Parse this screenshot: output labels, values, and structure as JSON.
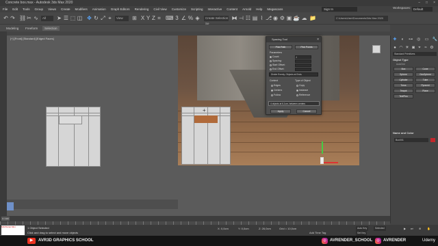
{
  "window": {
    "title": "Concrete box.max - Autodesk 3ds Max 2020"
  },
  "menu": {
    "items": [
      "File",
      "Edit",
      "Tools",
      "Group",
      "Views",
      "Create",
      "Modifiers",
      "Animation",
      "Graph Editors",
      "Rendering",
      "Civil View",
      "Customize",
      "Scripting",
      "Interactive",
      "Content",
      "Arnold",
      "Help",
      "Megascans"
    ],
    "sign_in": "Sign In",
    "workspaces_label": "Workspaces:",
    "workspace_value": "Default"
  },
  "toolbar": {
    "selection_filter": "All",
    "view_dropdown": "View",
    "create_selection_set": "Create Selection Se",
    "path": "C:\\Users\\User\\Documents\\3ds Max 2020"
  },
  "ribbon": {
    "tabs": [
      "Modeling",
      "Freeform",
      "Selection"
    ],
    "active": "Selection"
  },
  "viewport_left": {
    "label": "[+] [Front] [Standard] [Edged Faces]"
  },
  "spacing_tool": {
    "title": "Spacing Tool",
    "pick_path": "Pick Path",
    "pick_points": "Pick Points",
    "parameters_label": "Parameters",
    "count_label": "Count:",
    "count_value": "4",
    "spacing_label": "Spacing:",
    "start_offset_label": "Start Offset:",
    "end_offset_label": "End Offset:",
    "distribution": "Divide Evenly, Objects at Ends",
    "context_label": "Context",
    "edges_label": "Edges",
    "centers_label": "Centers",
    "follow_label": "Follow",
    "type_label": "Type of Object",
    "copy_label": "Copy",
    "instance_label": "Instance",
    "reference_label": "Reference",
    "status": "4 objects at 6,1cm, between centers",
    "apply": "Apply",
    "cancel": "Cancel"
  },
  "command_panel": {
    "category": "Standard Primitives",
    "object_type_label": "Object Type",
    "autogrid_label": "AutoGrid",
    "buttons": [
      "Box",
      "Cone",
      "Sphere",
      "GeoSphere",
      "Cylinder",
      "Tube",
      "Torus",
      "Pyramid",
      "Teapot",
      "Plane",
      "TextPlus"
    ],
    "name_color_label": "Name and Color",
    "object_name": "Box001"
  },
  "timeline": {
    "frame_display": "0 / 100"
  },
  "status": {
    "selection": "1 Object Selected",
    "prompt": "Click and drag to select and move objects",
    "maxscript": "MAXScript Mini",
    "x_value": "X: 0,0cm",
    "y_value": "Y: 0,0cm",
    "z_value": "Z: 26,0cm",
    "grid_value": "Grid = 10,0cm",
    "add_time_tag": "Add Time Tag",
    "auto_key": "Auto Key",
    "set_key": "Set Key",
    "selected": "Selected"
  },
  "branding": {
    "channel": "AVR3D GRAPHICS SCHOOL",
    "instagram_1": "AVRENDER_SCHOOL",
    "instagram_2": "AVRENDER",
    "platform": "Udemy"
  },
  "colors": {
    "accent": "#5aa8ff",
    "object_color": "#c3272b"
  }
}
